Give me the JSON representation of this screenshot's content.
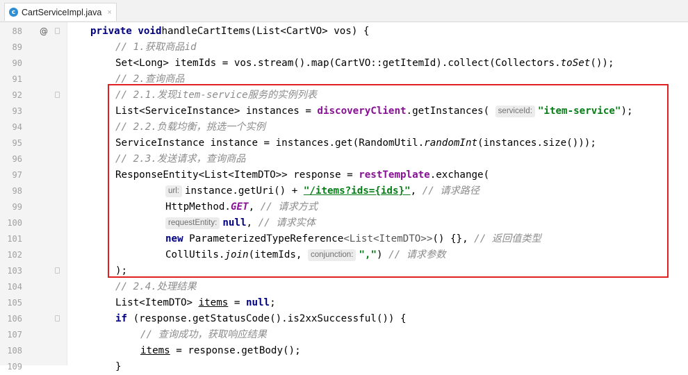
{
  "tab": {
    "icon_letter": "c",
    "label": "CartServiceImpl.java",
    "close": "×"
  },
  "gutter_mark": "@",
  "colors": {
    "keyword": "#000080",
    "comment": "#8c8c8c",
    "string": "#067d17",
    "field": "#871094",
    "highlight_box": "#e02020"
  },
  "lines": [
    {
      "n": "88",
      "indent": 0,
      "fold": true,
      "segs": [
        [
          "kw",
          "private void"
        ],
        [
          "",
          "handleCartItems(List<CartVO> vos) {"
        ]
      ]
    },
    {
      "n": "89",
      "indent": 1,
      "fold": false,
      "segs": [
        [
          "cm",
          "// 1.获取商品id"
        ]
      ]
    },
    {
      "n": "90",
      "indent": 1,
      "fold": false,
      "segs": [
        [
          "",
          "Set<Long> itemIds = vos.stream().map(CartVO::getItemId).collect(Collectors."
        ],
        [
          "ital",
          "toSet"
        ],
        [
          "",
          "());"
        ]
      ]
    },
    {
      "n": "91",
      "indent": 1,
      "fold": false,
      "segs": [
        [
          "cm",
          "// 2.查询商品"
        ]
      ]
    },
    {
      "n": "92",
      "indent": 1,
      "fold": true,
      "segs": [
        [
          "cm",
          "// 2.1.发现item-service服务的实例列表"
        ]
      ]
    },
    {
      "n": "93",
      "indent": 1,
      "fold": false,
      "segs": [
        [
          "",
          "List<ServiceInstance> instances = "
        ],
        [
          "fld",
          "discoveryClient"
        ],
        [
          "",
          ".getInstances( "
        ],
        [
          "hint",
          "serviceId:"
        ],
        [
          "str",
          "\"item-service\""
        ],
        [
          "",
          ");"
        ]
      ]
    },
    {
      "n": "94",
      "indent": 1,
      "fold": false,
      "segs": [
        [
          "cm",
          "// 2.2.负载均衡，挑选一个实例"
        ]
      ]
    },
    {
      "n": "95",
      "indent": 1,
      "fold": false,
      "segs": [
        [
          "",
          "ServiceInstance instance = instances.get(RandomUtil."
        ],
        [
          "ital",
          "randomInt"
        ],
        [
          "",
          "(instances.size()));"
        ]
      ]
    },
    {
      "n": "96",
      "indent": 1,
      "fold": false,
      "segs": [
        [
          "cm",
          "// 2.3.发送请求，查询商品"
        ]
      ]
    },
    {
      "n": "97",
      "indent": 1,
      "fold": false,
      "segs": [
        [
          "",
          "ResponseEntity<List<ItemDTO>> response = "
        ],
        [
          "fld",
          "restTemplate"
        ],
        [
          "",
          ".exchange("
        ]
      ]
    },
    {
      "n": "98",
      "indent": 3,
      "fold": false,
      "segs": [
        [
          "hint",
          "url:"
        ],
        [
          "",
          "instance.getUri() + "
        ],
        [
          "str ul",
          "\"/items?ids={ids}\""
        ],
        [
          "",
          ", "
        ],
        [
          "cm",
          "// 请求路径"
        ]
      ]
    },
    {
      "n": "99",
      "indent": 3,
      "fold": false,
      "segs": [
        [
          "",
          "HttpMethod."
        ],
        [
          "fld ital",
          "GET"
        ],
        [
          "",
          ", "
        ],
        [
          "cm",
          "// 请求方式"
        ]
      ]
    },
    {
      "n": "100",
      "indent": 3,
      "fold": false,
      "segs": [
        [
          "hint",
          "requestEntity:"
        ],
        [
          "kw",
          "null"
        ],
        [
          "",
          ", "
        ],
        [
          "cm",
          "// 请求实体"
        ]
      ]
    },
    {
      "n": "101",
      "indent": 3,
      "fold": false,
      "segs": [
        [
          "kw",
          "new"
        ],
        [
          "",
          " ParameterizedTypeReference"
        ],
        [
          "gen",
          "<List<ItemDTO>>"
        ],
        [
          "",
          "() {}, "
        ],
        [
          "cm",
          "// 返回值类型"
        ]
      ]
    },
    {
      "n": "102",
      "indent": 3,
      "fold": false,
      "segs": [
        [
          "",
          "CollUtils."
        ],
        [
          "ital",
          "join"
        ],
        [
          "",
          "(itemIds, "
        ],
        [
          "hint",
          "conjunction:"
        ],
        [
          "str",
          "\",\""
        ],
        [
          "",
          ") "
        ],
        [
          "cm",
          "// 请求参数"
        ]
      ]
    },
    {
      "n": "103",
      "indent": 1,
      "fold": true,
      "segs": [
        [
          "",
          ");"
        ]
      ]
    },
    {
      "n": "104",
      "indent": 1,
      "fold": false,
      "segs": [
        [
          "cm",
          "// 2.4.处理结果"
        ]
      ]
    },
    {
      "n": "105",
      "indent": 1,
      "fold": false,
      "segs": [
        [
          "",
          "List<ItemDTO> "
        ],
        [
          "ul",
          "items"
        ],
        [
          "",
          " = "
        ],
        [
          "kw",
          "null"
        ],
        [
          "",
          ";"
        ]
      ]
    },
    {
      "n": "106",
      "indent": 1,
      "fold": true,
      "segs": [
        [
          "kw",
          "if"
        ],
        [
          "",
          " (response.getStatusCode().is2xxSuccessful()) {"
        ]
      ]
    },
    {
      "n": "107",
      "indent": 2,
      "fold": false,
      "segs": [
        [
          "cm",
          "// 查询成功，获取响应结果"
        ]
      ]
    },
    {
      "n": "108",
      "indent": 2,
      "fold": false,
      "segs": [
        [
          "ul",
          "items"
        ],
        [
          "",
          " = response.getBody();"
        ]
      ]
    },
    {
      "n": "109",
      "indent": 1,
      "fold": false,
      "segs": [
        [
          "",
          "}"
        ]
      ]
    }
  ]
}
